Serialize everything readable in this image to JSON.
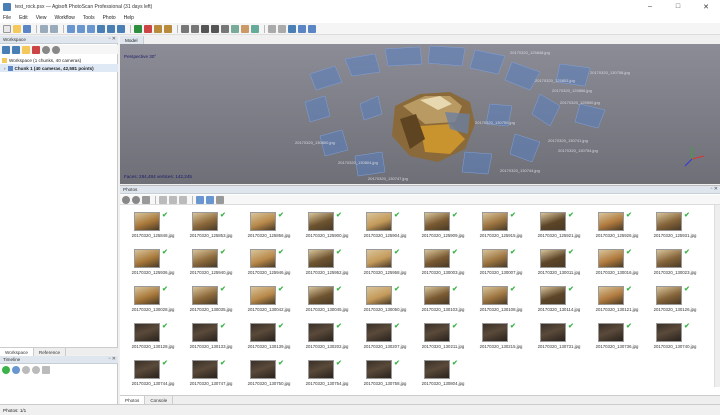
{
  "window": {
    "title": "test_rock.psx — Agisoft PhotoScan Professional (31 days left)",
    "controls": [
      "–",
      "□",
      "✕"
    ]
  },
  "menu": [
    "File",
    "Edit",
    "View",
    "Workflow",
    "Tools",
    "Photo",
    "Help"
  ],
  "workspace": {
    "header": "Workspace",
    "root": "Workspace (1 chunks, 40 cameras)",
    "chunk": "Chunk 1 (40 cameras, 42,581 points)"
  },
  "left_tabs": [
    "Workspace",
    "Reference"
  ],
  "timeline": {
    "header": "Timeline"
  },
  "model": {
    "tab": "Model",
    "perspective": "Perspective 30°",
    "stats": "Faces: 284,484 vertices: 142,245",
    "camera_labels": [
      "20170320_125848.jpg",
      "20170320_125853.jpg",
      "20170320_125856.jpg",
      "20170320_125900.jpg",
      "20170320_130741.jpg",
      "20170320_130744.jpg",
      "20170320_130747.jpg",
      "20170320_130750.jpg",
      "20170320_130754.jpg",
      "20170320_130758.jpg",
      "20170320_130804.jpg",
      "20170320_130800.jpg"
    ]
  },
  "photos": {
    "header": "Photos",
    "labels": [
      "20170320_125848.jpg",
      "20170320_125853.jpg",
      "20170320_125856.jpg",
      "20170320_125900.jpg",
      "20170320_125904.jpg",
      "20170320_125909.jpg",
      "20170320_125915.jpg",
      "20170320_125921.jpg",
      "20170320_125926.jpg",
      "20170320_125931.jpg",
      "20170320_125936.jpg",
      "20170320_125940.jpg",
      "20170320_125946.jpg",
      "20170320_125952.jpg",
      "20170320_125958.jpg",
      "20170320_130003.jpg",
      "20170320_130007.jpg",
      "20170320_130011.jpg",
      "20170320_130016.jpg",
      "20170320_130023.jpg",
      "20170320_130028.jpg",
      "20170320_130035.jpg",
      "20170320_130042.jpg",
      "20170320_130045.jpg",
      "20170320_130050.jpg",
      "20170320_130103.jpg",
      "20170320_130108.jpg",
      "20170320_130114.jpg",
      "20170320_130121.jpg",
      "20170320_130126.jpg",
      "20170320_130128.jpg",
      "20170320_130133.jpg",
      "20170320_130139.jpg",
      "20170320_130202.jpg",
      "20170320_130207.jpg",
      "20170320_130211.jpg",
      "20170320_130215.jpg",
      "20170320_130731.jpg",
      "20170320_130736.jpg",
      "20170320_130740.jpg",
      "20170320_130744.jpg",
      "20170320_130747.jpg",
      "20170320_130750.jpg",
      "20170320_130754.jpg",
      "20170320_130758.jpg",
      "20170320_130804.jpg"
    ]
  },
  "bottom_tabs": [
    "Photos",
    "Console"
  ],
  "status": "Photos: 1/1",
  "colors": {
    "check": "#3cb34a",
    "camera_plane": "#5a7fc0",
    "panel_header": "#dfe6ee"
  }
}
